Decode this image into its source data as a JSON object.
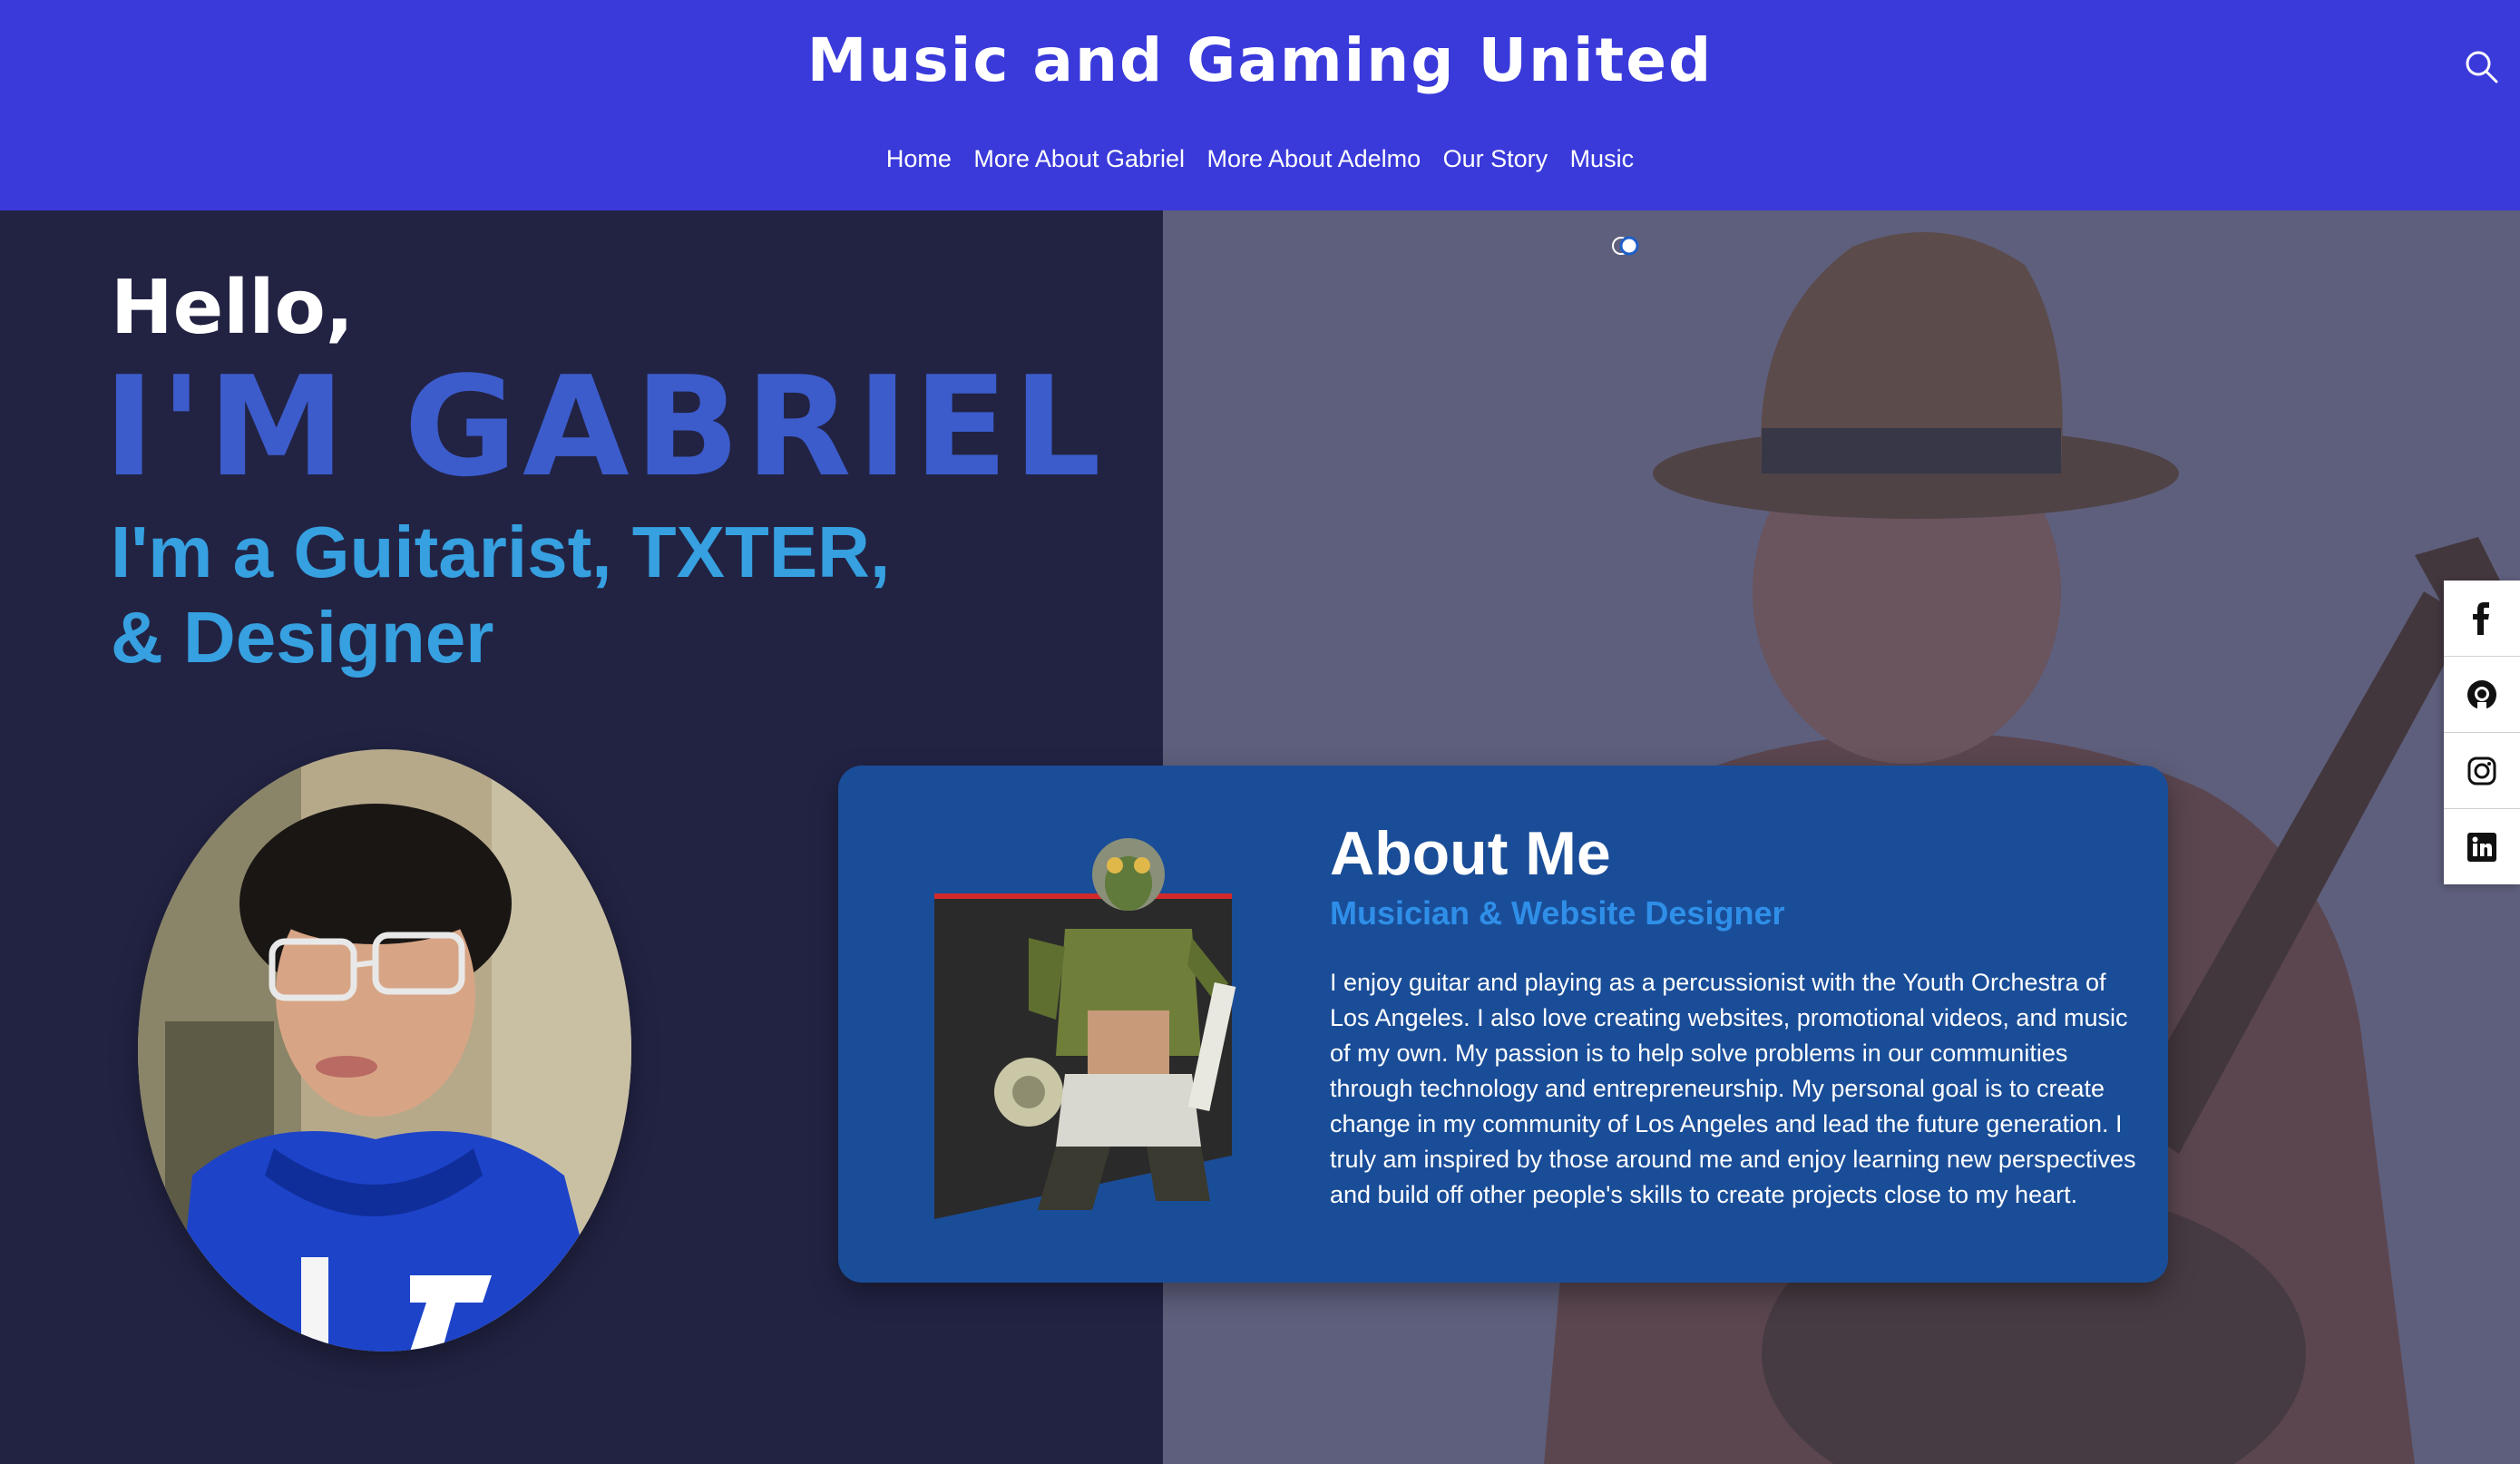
{
  "header": {
    "site_title": "Music and Gaming United",
    "search_icon": "search-icon",
    "nav": [
      {
        "label": "Home"
      },
      {
        "label": "More About Gabriel"
      },
      {
        "label": "More About Adelmo"
      },
      {
        "label": "Our Story"
      },
      {
        "label": "Music"
      }
    ]
  },
  "hero": {
    "greeting": "Hello,",
    "name": "I'M GABRIEL",
    "roles_line1": "I'm a Guitarist, TXTER,",
    "roles_line2": "& Designer"
  },
  "about": {
    "title": "About Me",
    "subtitle": "Musician & Website Designer",
    "body": "I enjoy guitar and playing as a percussionist with the Youth Orchestra of Los Angeles. I also love creating websites, promotional videos, and music of my own. My passion is to help solve problems in our communities through technology and entrepreneurship. My personal goal is to create change in my community of Los Angeles and lead the future generation. I truly am inspired by those around me and enjoy learning new perspectives and build off other people's skills to create projects close to my heart."
  },
  "social": [
    {
      "icon": "facebook-icon"
    },
    {
      "icon": "github-icon"
    },
    {
      "icon": "instagram-icon"
    },
    {
      "icon": "linkedin-icon"
    }
  ],
  "colors": {
    "header_bg": "#3a3adb",
    "panel_bg": "#222343",
    "name_blue": "#3c5ccc",
    "roles_blue": "#36a0e0",
    "card_bg": "#1a4d98",
    "subtitle_blue": "#2f8fe8"
  }
}
